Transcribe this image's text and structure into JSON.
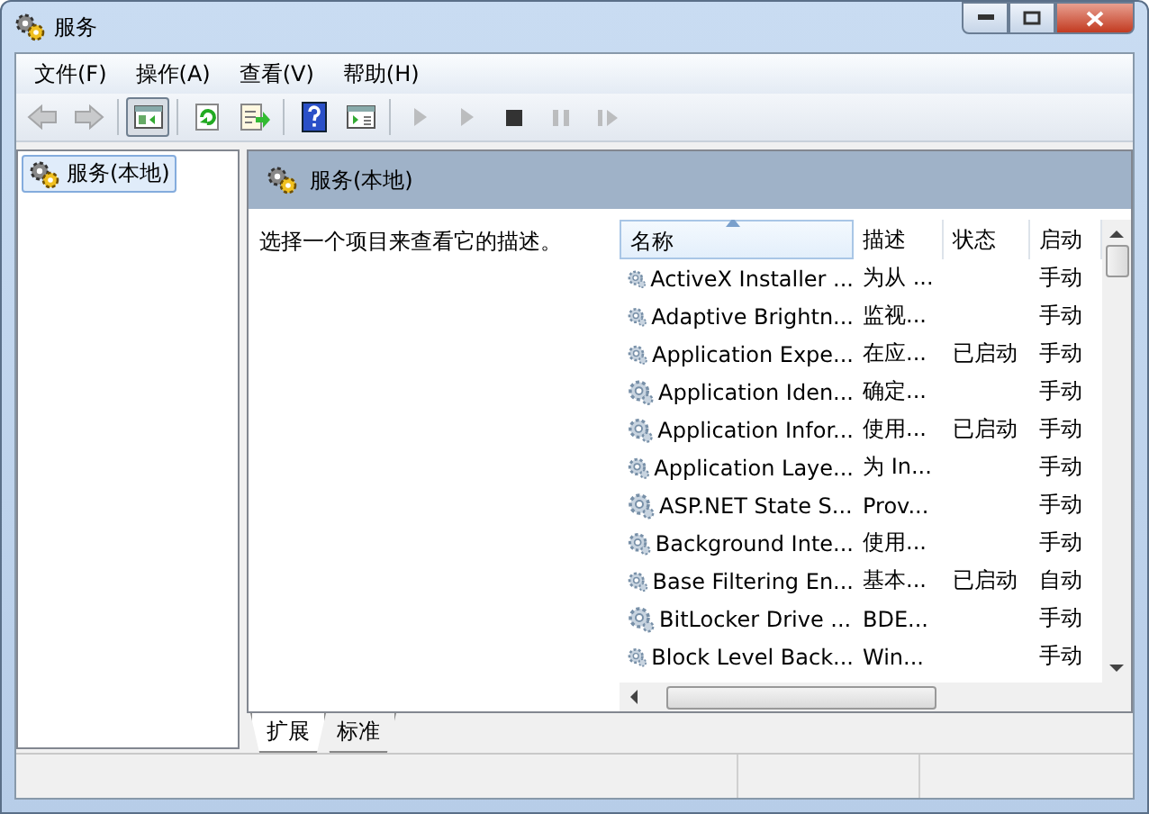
{
  "window": {
    "title": "服务"
  },
  "menu": [
    "文件(F)",
    "操作(A)",
    "查看(V)",
    "帮助(H)"
  ],
  "toolbar": [
    {
      "kind": "back",
      "disabled": true,
      "pressed": false
    },
    {
      "kind": "forward",
      "disabled": true,
      "pressed": false
    },
    {
      "kind": "tree",
      "disabled": false,
      "pressed": true
    },
    {
      "kind": "refresh",
      "disabled": false,
      "pressed": false
    },
    {
      "kind": "export",
      "disabled": false,
      "pressed": false
    },
    {
      "kind": "help",
      "disabled": false,
      "pressed": false
    },
    {
      "kind": "properties",
      "disabled": false,
      "pressed": false
    },
    {
      "kind": "start",
      "disabled": true,
      "pressed": false
    },
    {
      "kind": "start",
      "disabled": true,
      "pressed": false
    },
    {
      "kind": "stop",
      "disabled": false,
      "pressed": false
    },
    {
      "kind": "pause",
      "disabled": true,
      "pressed": false
    },
    {
      "kind": "resume",
      "disabled": true,
      "pressed": false
    }
  ],
  "tree": {
    "items": [
      {
        "label": "服务(本地)",
        "selected": true
      }
    ]
  },
  "panel": {
    "title": "服务(本地)",
    "description": "选择一个项目来查看它的描述。"
  },
  "table": {
    "columns": [
      {
        "label": "名称",
        "sorted": true
      },
      {
        "label": "描述",
        "sorted": false
      },
      {
        "label": "状态",
        "sorted": false
      },
      {
        "label": "启动",
        "sorted": false
      }
    ],
    "rows": [
      [
        "ActiveX Installer ...",
        "为从 ...",
        "",
        "手动"
      ],
      [
        "Adaptive Brightn...",
        "监视...",
        "",
        "手动"
      ],
      [
        "Application Expe...",
        "在应...",
        "已启动",
        "手动"
      ],
      [
        "Application Iden...",
        "确定...",
        "",
        "手动"
      ],
      [
        "Application Infor...",
        "使用...",
        "已启动",
        "手动"
      ],
      [
        "Application Laye...",
        "为 In...",
        "",
        "手动"
      ],
      [
        "ASP.NET State S...",
        "Prov...",
        "",
        "手动"
      ],
      [
        "Background Inte...",
        "使用...",
        "",
        "手动"
      ],
      [
        "Base Filtering En...",
        "基本...",
        "已启动",
        "自动"
      ],
      [
        "BitLocker Drive ...",
        "BDE...",
        "",
        "手动"
      ],
      [
        "Block Level Back...",
        "Win...",
        "",
        "手动"
      ]
    ]
  },
  "tabs": [
    {
      "label": "扩展",
      "selected": true
    },
    {
      "label": "标准",
      "selected": false
    }
  ]
}
